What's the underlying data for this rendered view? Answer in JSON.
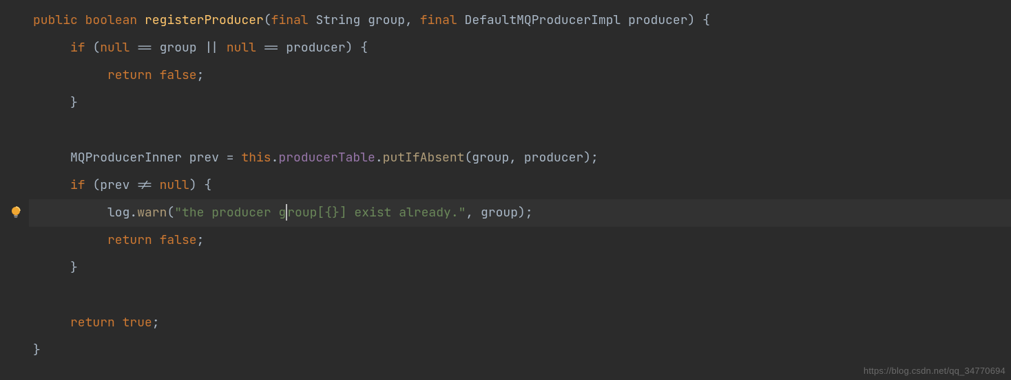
{
  "code": {
    "lines": [
      {
        "indent": 0,
        "segments": [
          {
            "cls": "kw",
            "t": "public"
          },
          {
            "cls": "punct",
            "t": " "
          },
          {
            "cls": "kw",
            "t": "boolean"
          },
          {
            "cls": "punct",
            "t": " "
          },
          {
            "cls": "method-decl",
            "t": "registerProducer"
          },
          {
            "cls": "punct",
            "t": "("
          },
          {
            "cls": "kw",
            "t": "final"
          },
          {
            "cls": "punct",
            "t": " "
          },
          {
            "cls": "ident",
            "t": "String group"
          },
          {
            "cls": "punct",
            "t": ", "
          },
          {
            "cls": "kw",
            "t": "final"
          },
          {
            "cls": "punct",
            "t": " "
          },
          {
            "cls": "ident",
            "t": "DefaultMQProducerImpl producer"
          },
          {
            "cls": "punct",
            "t": ") {"
          }
        ]
      },
      {
        "indent": 1,
        "segments": [
          {
            "cls": "kw",
            "t": "if"
          },
          {
            "cls": "punct",
            "t": " ("
          },
          {
            "cls": "kw",
            "t": "null"
          },
          {
            "cls": "punct",
            "t": " == group || "
          },
          {
            "cls": "kw",
            "t": "null"
          },
          {
            "cls": "punct",
            "t": " == producer) {"
          }
        ]
      },
      {
        "indent": 2,
        "segments": [
          {
            "cls": "kw",
            "t": "return false"
          },
          {
            "cls": "punct",
            "t": ";"
          }
        ]
      },
      {
        "indent": 1,
        "segments": [
          {
            "cls": "punct",
            "t": "}"
          }
        ]
      },
      {
        "indent": 0,
        "segments": []
      },
      {
        "indent": 1,
        "segments": [
          {
            "cls": "ident",
            "t": "MQProducerInner prev = "
          },
          {
            "cls": "kw",
            "t": "this"
          },
          {
            "cls": "punct",
            "t": "."
          },
          {
            "cls": "field",
            "t": "producerTable"
          },
          {
            "cls": "punct",
            "t": "."
          },
          {
            "cls": "method-call",
            "t": "putIfAbsent"
          },
          {
            "cls": "punct",
            "t": "(group, producer);"
          }
        ]
      },
      {
        "indent": 1,
        "segments": [
          {
            "cls": "kw",
            "t": "if"
          },
          {
            "cls": "punct",
            "t": " (prev != "
          },
          {
            "cls": "kw",
            "t": "null"
          },
          {
            "cls": "punct",
            "t": ") {"
          }
        ]
      },
      {
        "indent": 2,
        "current": true,
        "segments": [
          {
            "cls": "ident",
            "t": "log."
          },
          {
            "cls": "method-call",
            "t": "warn"
          },
          {
            "cls": "punct",
            "t": "("
          },
          {
            "cls": "str",
            "t": "\"the producer g"
          },
          {
            "cls": "caret",
            "t": ""
          },
          {
            "cls": "str",
            "t": "roup[{}] exist already.\""
          },
          {
            "cls": "punct",
            "t": ", group);"
          }
        ]
      },
      {
        "indent": 2,
        "segments": [
          {
            "cls": "kw",
            "t": "return false"
          },
          {
            "cls": "punct",
            "t": ";"
          }
        ]
      },
      {
        "indent": 1,
        "segments": [
          {
            "cls": "punct",
            "t": "}"
          }
        ]
      },
      {
        "indent": 0,
        "segments": []
      },
      {
        "indent": 1,
        "segments": [
          {
            "cls": "kw",
            "t": "return true"
          },
          {
            "cls": "punct",
            "t": ";"
          }
        ]
      },
      {
        "indent": 0,
        "segments": [
          {
            "cls": "punct",
            "t": "}"
          }
        ]
      }
    ],
    "indent_unit": "     ",
    "bulb_line_index": 7
  },
  "watermark": "https://blog.csdn.net/qq_34770694"
}
